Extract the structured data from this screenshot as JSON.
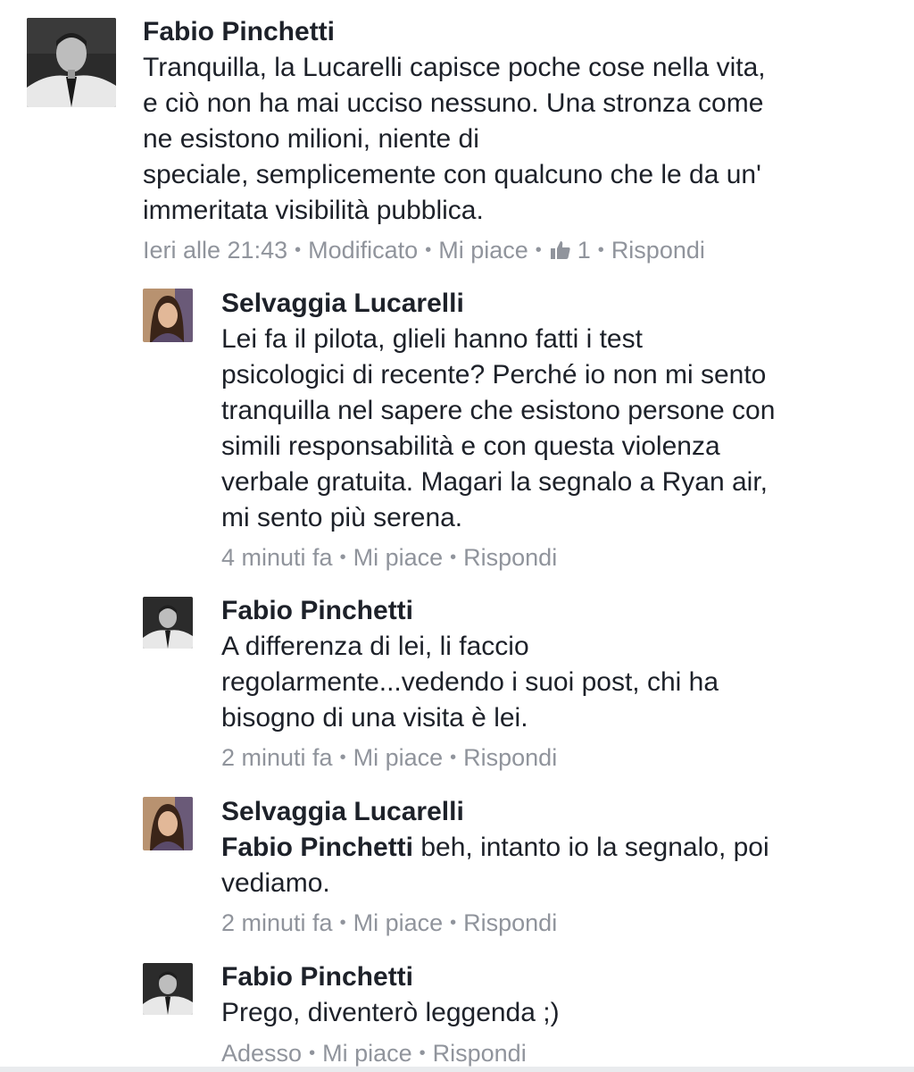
{
  "colors": {
    "text": "#1d2129",
    "meta": "#90949c",
    "background": "#ffffff"
  },
  "comments": [
    {
      "author": "Fabio Pinchetti",
      "lines": [
        "Tranquilla, la Lucarelli capisce poche cose nella vita,",
        "e ciò non ha mai ucciso nessuno. Una stronza come",
        "ne esistono milioni, niente di",
        "speciale, semplicemente con qualcuno che le da un'",
        "immeritata visibilità pubblica."
      ],
      "time": "Ieri alle 21:43",
      "edited": "Modificato",
      "like_label": "Mi piace",
      "like_icon": "thumbs-up-icon",
      "like_count": "1",
      "reply_label": "Rispondi"
    },
    {
      "author": "Selvaggia Lucarelli",
      "lines": [
        "Lei fa il pilota, glieli hanno fatti i test",
        "psicologici di recente? Perché io non mi sento",
        "tranquilla nel sapere che esistono persone con",
        "simili responsabilità e con questa violenza",
        "verbale gratuita. Magari la segnalo a Ryan air,",
        "mi sento più serena."
      ],
      "time": "4 minuti fa",
      "like_label": "Mi piace",
      "reply_label": "Rispondi"
    },
    {
      "author": "Fabio Pinchetti",
      "lines": [
        "A differenza di lei, li faccio",
        "regolarmente...vedendo i suoi post, chi ha",
        "bisogno di una visita è lei."
      ],
      "time": "2 minuti fa",
      "like_label": "Mi piace",
      "reply_label": "Rispondi"
    },
    {
      "author": "Selvaggia Lucarelli",
      "tag": "Fabio Pinchetti",
      "lines": [
        " beh, intanto io la segnalo, poi",
        "vediamo."
      ],
      "time": "2 minuti fa",
      "like_label": "Mi piace",
      "reply_label": "Rispondi"
    },
    {
      "author": "Fabio Pinchetti",
      "lines": [
        "Prego, diventerò leggenda ;)"
      ],
      "time": "Adesso",
      "like_label": "Mi piace",
      "reply_label": "Rispondi"
    }
  ]
}
